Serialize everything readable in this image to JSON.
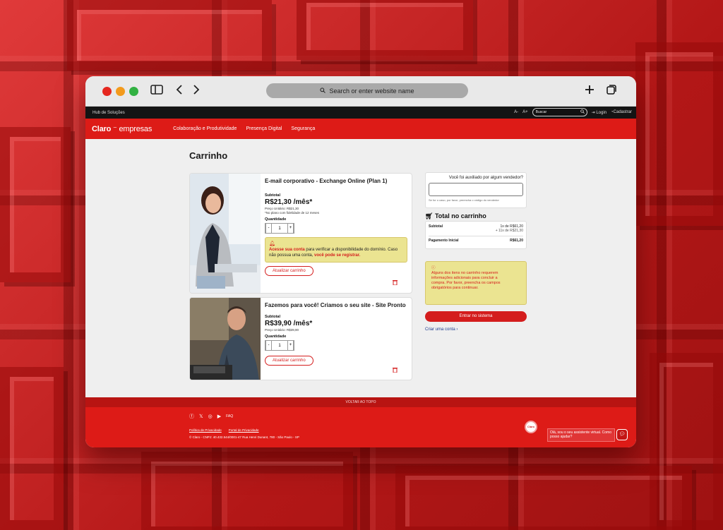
{
  "browser": {
    "url_placeholder": "Search or enter website name",
    "icons": [
      "sidebar-icon",
      "back-icon",
      "forward-icon",
      "search-icon",
      "new-tab-icon",
      "tabs-icon"
    ]
  },
  "topbar": {
    "hub": "Hub de Soluções",
    "font_minus": "A-",
    "font_plus": "A+",
    "search_placeholder": "Buscar",
    "login": "Login",
    "signup": "Cadastrar"
  },
  "nav": {
    "logo_brand": "Claro",
    "logo_suffix": "empresas",
    "items": [
      "Colaboração e Produtividade",
      "Presença Digital",
      "Segurança"
    ]
  },
  "page": {
    "title": "Carrinho"
  },
  "items": [
    {
      "title": "E-mail corporativo - Exchange Online (Plan 1)",
      "subtotal_label": "Subtotal",
      "price": "R$21,30 /mês*",
      "unit_price": "Preço Unitário: R$21,30",
      "note": "*No plano com fidelidade de 12 meses",
      "qty_label": "Quantidade",
      "qty": "1",
      "alert_link1": "Acesse sua conta",
      "alert_text1": " para verificar a disponibilidade do domínio. Caso não possua uma conta, ",
      "alert_link2": "você pode se registrar.",
      "update_label": "Atualizar carrinho"
    },
    {
      "title": "Fazemos para você! Criamos o seu site - Site Pronto",
      "subtotal_label": "Subtotal",
      "price": "R$39,90 /mês*",
      "unit_price": "Preço Unitário: R$39,90",
      "qty_label": "Quantidade",
      "qty": "1",
      "update_label": "Atualizar carrinho"
    }
  ],
  "sidebar": {
    "vendor_question": "Você foi auxiliado por algum vendedor?",
    "vendor_hint": "Se for o caso, por favor, preencha o código do vendedor",
    "total_title": "Total no carrinho",
    "subtotal_label": "Subtotal",
    "subtotal_line1": "1x de R$61,20",
    "subtotal_line2": "+ 11x de R$21,30",
    "initial_label": "Pagamento Inicial",
    "initial_value": "R$61,20",
    "warning": "Alguns dos itens no carrinho requerem informações adicionais para concluir a compra. Por favor, preencha os campos obrigatórios para continuar.",
    "enter_button": "Entrar no sistema",
    "create_account": "Criar uma conta"
  },
  "footer": {
    "back_to_top": "VOLTAR AO TOPO",
    "faq": "FAQ",
    "privacy_policy": "Política de Privacidade",
    "privacy_portal": "Portal de Privacidade",
    "copyright": "© Claro - CNPJ: 40.432.544/0001-47 Rua Henri Dunant, 780 - São Paulo - SP",
    "bot_label": "Claro",
    "chat_text": "Olá, sou o seu assistente virtual. Como posso ajudar?"
  },
  "colors": {
    "brand_red": "#dd1b17",
    "alert_yellow": "#ebe491",
    "topbar_black": "#141414"
  }
}
